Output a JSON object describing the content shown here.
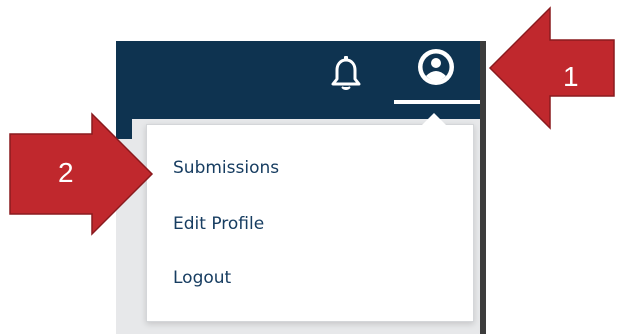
{
  "header": {
    "bell_icon": "bell-icon",
    "user_icon": "user-circle-icon",
    "background_color": "#0e3350"
  },
  "dropdown": {
    "items": [
      {
        "label": "Submissions"
      },
      {
        "label": "Edit Profile"
      },
      {
        "label": "Logout"
      }
    ],
    "text_color": "#173d61"
  },
  "callouts": {
    "first": "1",
    "second": "2",
    "color": "#c0282d"
  }
}
